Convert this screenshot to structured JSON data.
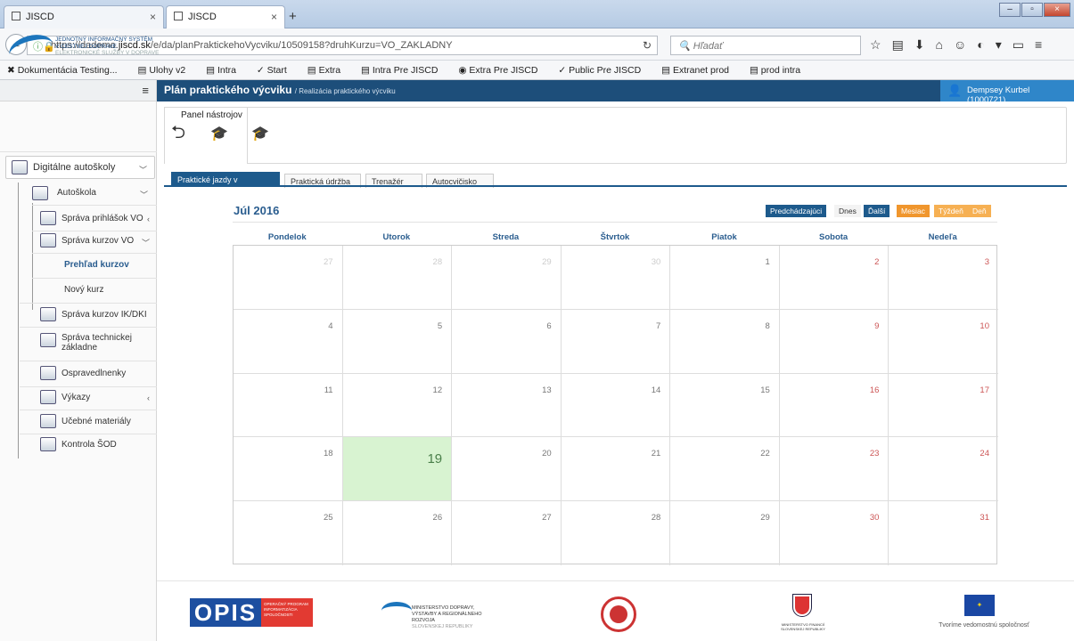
{
  "browser": {
    "tabs": [
      {
        "title": "JISCD"
      },
      {
        "title": "JISCD"
      }
    ],
    "new_tab": "+",
    "url_prefix": "https://dademo.",
    "url_domain": "jiscd.sk",
    "url_rest": "/e/da/planPraktickehoVycviku/10509158?druhKurzu=VO_ZAKLADNY",
    "search_placeholder": "Hľadať",
    "bookmarks": [
      "Dokumentácia Testing...",
      "Ulohy v2",
      "Intra",
      "Start",
      "Extra",
      "Intra Pre JISCD",
      "Extra Pre JISCD",
      "Public Pre JISCD",
      "Extranet prod",
      "prod intra"
    ]
  },
  "logo": {
    "line1": "JEDNOTNÝ INFORMAČNÝ SYSTÉM",
    "line2": "V CESTNEJ DOPRAVE",
    "line3": "ELEKTRONICKÉ SLUŽBY V DOPRAVE"
  },
  "sidebar": {
    "group": "Digitálne autoškoly",
    "items": [
      {
        "label": "Autoškola"
      },
      {
        "label": "Správa prihlášok VO"
      },
      {
        "label": "Správa kurzov VO"
      },
      {
        "label": "Prehľad kurzov"
      },
      {
        "label": "Nový kurz"
      },
      {
        "label": "Správa kurzov IK/DKI"
      },
      {
        "label": "Správa technickej"
      },
      {
        "label": "základne"
      },
      {
        "label": "Ospravedlnenky"
      },
      {
        "label": "Výkazy"
      },
      {
        "label": "Učebné materiály"
      },
      {
        "label": "Kontrola ŠOD"
      }
    ]
  },
  "header": {
    "title": "Plán praktického výcviku",
    "subtitle": "/ Realizácia praktického výcviku",
    "user": "Dempsey Kurbel (1000721)"
  },
  "panel": {
    "title": "Panel nástrojov"
  },
  "tabs": [
    "Praktické jazdy v premávke",
    "Praktická údržba",
    "Trenažér",
    "Autocvičisko"
  ],
  "calendar": {
    "title": "Júl 2016",
    "nav": [
      "Predchádzajúci",
      "Dnes",
      "Ďalší"
    ],
    "views": [
      "Mesiac",
      "Týždeň",
      "Deň"
    ],
    "weekdays": [
      "Pondelok",
      "Utorok",
      "Streda",
      "Štvrtok",
      "Piatok",
      "Sobota",
      "Nedeľa"
    ],
    "weeks": [
      [
        "27",
        "28",
        "29",
        "30",
        "1",
        "2",
        "3"
      ],
      [
        "4",
        "5",
        "6",
        "7",
        "8",
        "9",
        "10"
      ],
      [
        "11",
        "12",
        "13",
        "14",
        "15",
        "16",
        "17"
      ],
      [
        "18",
        "19",
        "20",
        "21",
        "22",
        "23",
        "24"
      ],
      [
        "25",
        "26",
        "27",
        "28",
        "29",
        "30",
        "31"
      ]
    ],
    "today": "19"
  },
  "footer": {
    "opis": "OPIS",
    "opis_sub": "OPERAČNÝ PROGRAM INFORMATIZÁCIA SPOLOČNOSTI",
    "ministry": "MINISTERSTVO DOPRAVY, VÝSTAVBY A REGIONÁLNEHO ROZVOJA",
    "ministry_sub": "SLOVENSKEJ REPUBLIKY",
    "finance": "MINISTERSTVO FINANCIÍ SLOVENSKEJ REPUBLIKY",
    "eu": "Tvoríme vedomostnú spoločnosť"
  }
}
